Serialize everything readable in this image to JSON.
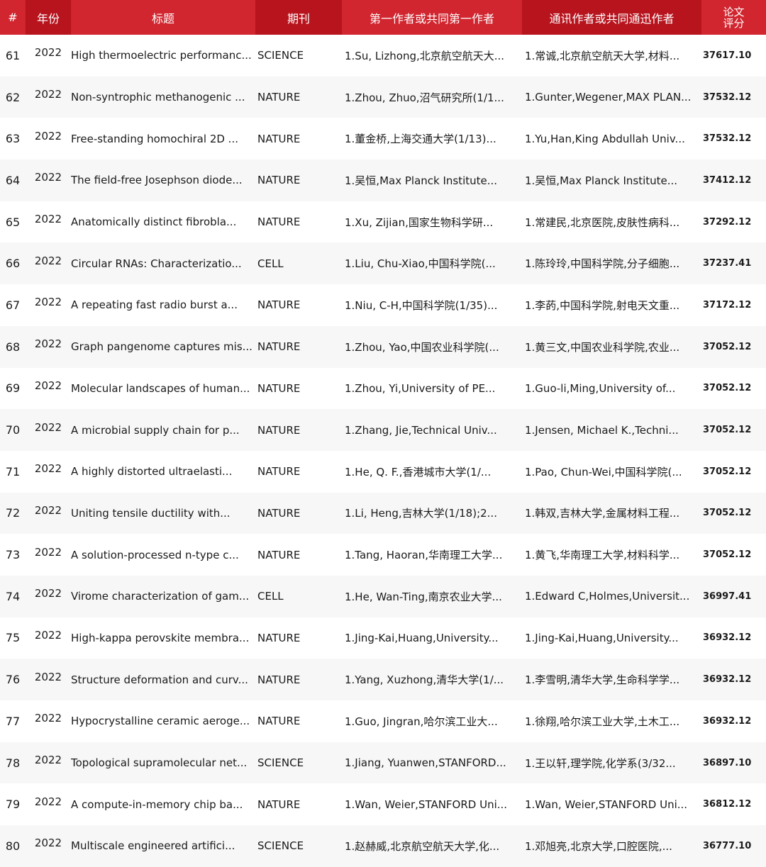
{
  "headers": {
    "num": "#",
    "year": "年份",
    "title": "标题",
    "journal": "期刊",
    "first_author": "第一作者或共同第一作者",
    "corresponding_author": "通讯作者或共同通迅作者",
    "score_line1": "论文",
    "score_line2": "评分"
  },
  "rows": [
    {
      "num": "61",
      "year": "2022",
      "title": "High thermoelectric performanc...",
      "journal": "SCIENCE",
      "first_author": "1.Su, Lizhong,北京航空航天大...",
      "corresponding_author": "1.常诚,北京航空航天大学,材料...",
      "score": "37617.10"
    },
    {
      "num": "62",
      "year": "2022",
      "title": "Non-syntrophic methanogenic ...",
      "journal": "NATURE",
      "first_author": "1.Zhou, Zhuo,沼气研究所(1/1...",
      "corresponding_author": "1.Gunter,Wegener,MAX PLAN...",
      "score": "37532.12"
    },
    {
      "num": "63",
      "year": "2022",
      "title": "Free-standing homochiral 2D ...",
      "journal": "NATURE",
      "first_author": "1.董金桥,上海交通大学(1/13)...",
      "corresponding_author": "1.Yu,Han,King Abdullah Univ...",
      "score": "37532.12"
    },
    {
      "num": "64",
      "year": "2022",
      "title": "The field-free Josephson diode...",
      "journal": "NATURE",
      "first_author": "1.吴恒,Max Planck Institute...",
      "corresponding_author": "1.吴恒,Max Planck Institute...",
      "score": "37412.12"
    },
    {
      "num": "65",
      "year": "2022",
      "title": "Anatomically distinct fibrobla...",
      "journal": "NATURE",
      "first_author": "1.Xu, Zijian,国家生物科学研...",
      "corresponding_author": "1.常建民,北京医院,皮肤性病科...",
      "score": "37292.12"
    },
    {
      "num": "66",
      "year": "2022",
      "title": "Circular RNAs: Characterizatio...",
      "journal": "CELL",
      "first_author": "1.Liu, Chu-Xiao,中国科学院(...",
      "corresponding_author": "1.陈玲玲,中国科学院,分子细胞...",
      "score": "37237.41"
    },
    {
      "num": "67",
      "year": "2022",
      "title": "A repeating fast radio burst a...",
      "journal": "NATURE",
      "first_author": "1.Niu, C-H,中国科学院(1/35)...",
      "corresponding_author": "1.李菂,中国科学院,射电天文重...",
      "score": "37172.12"
    },
    {
      "num": "68",
      "year": "2022",
      "title": "Graph pangenome captures mis...",
      "journal": "NATURE",
      "first_author": "1.Zhou, Yao,中国农业科学院(...",
      "corresponding_author": "1.黄三文,中国农业科学院,农业...",
      "score": "37052.12"
    },
    {
      "num": "69",
      "year": "2022",
      "title": "Molecular landscapes of human...",
      "journal": "NATURE",
      "first_author": "1.Zhou, Yi,University of PE...",
      "corresponding_author": "1.Guo-li,Ming,University of...",
      "score": "37052.12"
    },
    {
      "num": "70",
      "year": "2022",
      "title": "A microbial supply chain for p...",
      "journal": "NATURE",
      "first_author": "1.Zhang, Jie,Technical Univ...",
      "corresponding_author": "1.Jensen, Michael K.,Techni...",
      "score": "37052.12"
    },
    {
      "num": "71",
      "year": "2022",
      "title": "A highly distorted ultraelasti...",
      "journal": "NATURE",
      "first_author": "1.He, Q. F.,香港城市大学(1/...",
      "corresponding_author": "1.Pao, Chun-Wei,中国科学院(...",
      "score": "37052.12"
    },
    {
      "num": "72",
      "year": "2022",
      "title": "Uniting tensile ductility with...",
      "journal": "NATURE",
      "first_author": "1.Li, Heng,吉林大学(1/18);2...",
      "corresponding_author": "1.韩双,吉林大学,金属材料工程...",
      "score": "37052.12"
    },
    {
      "num": "73",
      "year": "2022",
      "title": "A solution-processed n-type c...",
      "journal": "NATURE",
      "first_author": "1.Tang, Haoran,华南理工大学...",
      "corresponding_author": "1.黄飞,华南理工大学,材料科学...",
      "score": "37052.12"
    },
    {
      "num": "74",
      "year": "2022",
      "title": "Virome characterization of gam...",
      "journal": "CELL",
      "first_author": "1.He, Wan-Ting,南京农业大学...",
      "corresponding_author": "1.Edward C,Holmes,Universit...",
      "score": "36997.41"
    },
    {
      "num": "75",
      "year": "2022",
      "title": "High-kappa perovskite membra...",
      "journal": "NATURE",
      "first_author": "1.Jing-Kai,Huang,University...",
      "corresponding_author": "1.Jing-Kai,Huang,University...",
      "score": "36932.12"
    },
    {
      "num": "76",
      "year": "2022",
      "title": "Structure deformation and curv...",
      "journal": "NATURE",
      "first_author": "1.Yang, Xuzhong,清华大学(1/...",
      "corresponding_author": "1.李雪明,清华大学,生命科学学...",
      "score": "36932.12"
    },
    {
      "num": "77",
      "year": "2022",
      "title": "Hypocrystalline ceramic aeroge...",
      "journal": "NATURE",
      "first_author": "1.Guo, Jingran,哈尔滨工业大...",
      "corresponding_author": "1.徐翔,哈尔滨工业大学,土木工...",
      "score": "36932.12"
    },
    {
      "num": "78",
      "year": "2022",
      "title": "Topological supramolecular net...",
      "journal": "SCIENCE",
      "first_author": "1.Jiang, Yuanwen,STANFORD...",
      "corresponding_author": "1.王以轩,理学院,化学系(3/32...",
      "score": "36897.10"
    },
    {
      "num": "79",
      "year": "2022",
      "title": "A compute-in-memory chip ba...",
      "journal": "NATURE",
      "first_author": "1.Wan, Weier,STANFORD Uni...",
      "corresponding_author": "1.Wan, Weier,STANFORD Uni...",
      "score": "36812.12"
    },
    {
      "num": "80",
      "year": "2022",
      "title": "Multiscale engineered artifici...",
      "journal": "SCIENCE",
      "first_author": "1.赵赫威,北京航空航天大学,化...",
      "corresponding_author": "1.邓旭亮,北京大学,口腔医院,...",
      "score": "36777.10"
    }
  ]
}
